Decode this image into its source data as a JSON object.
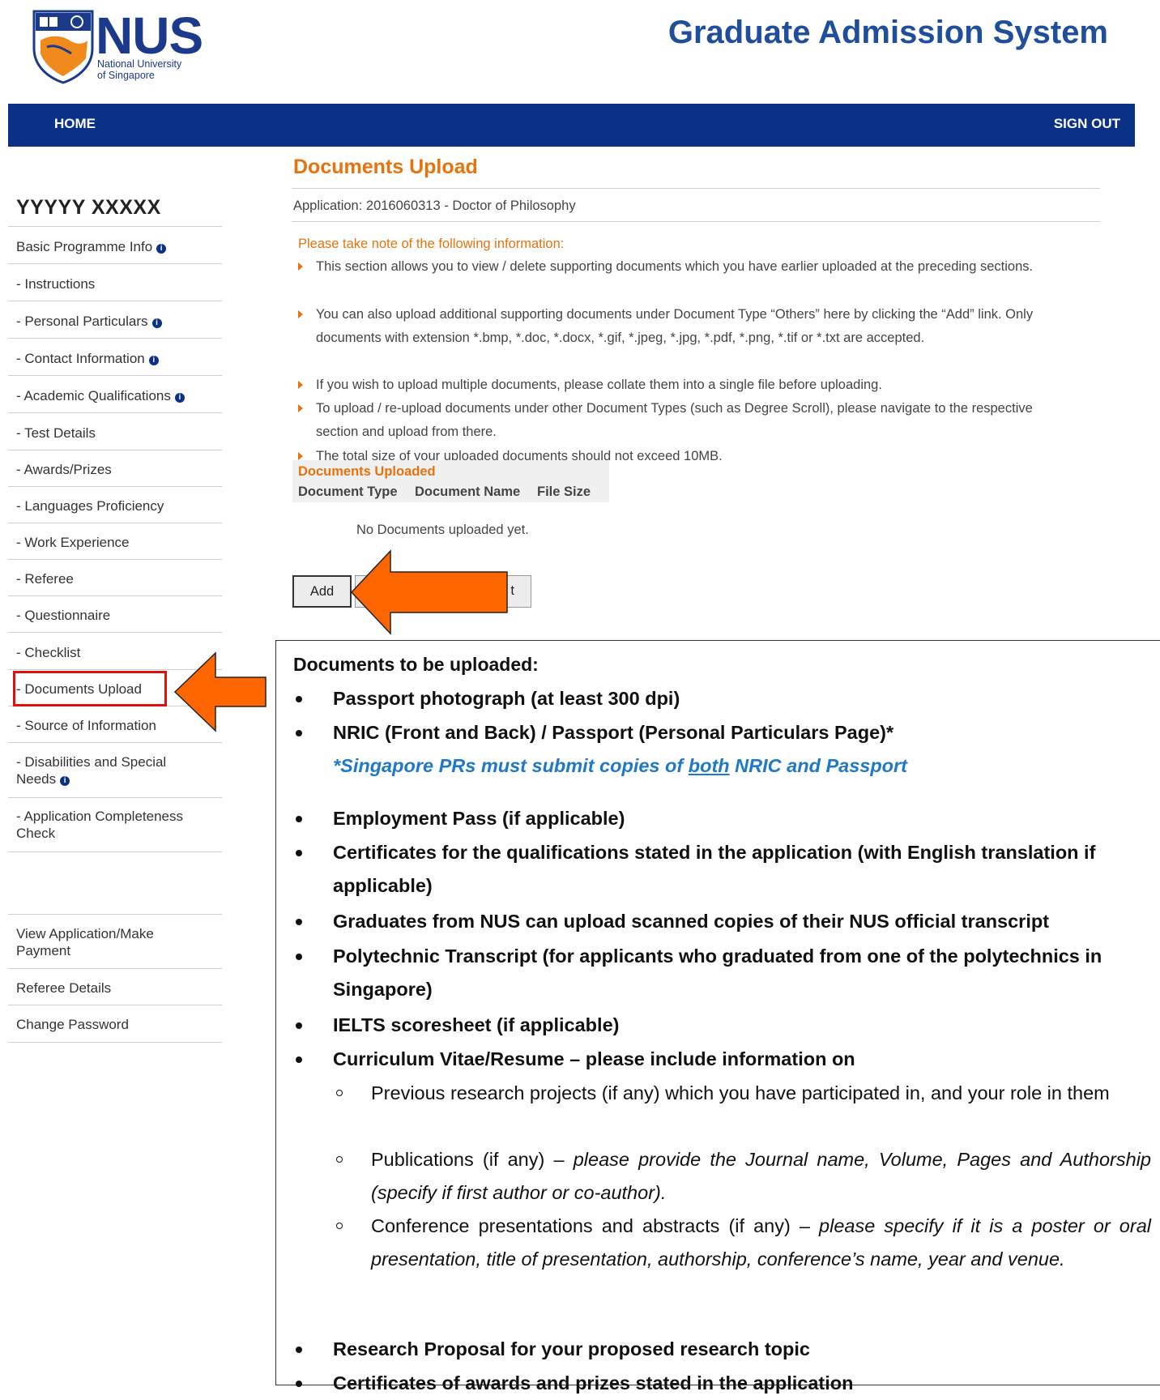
{
  "header": {
    "logo_text": "NUS",
    "logo_subtitle_1": "National University",
    "logo_subtitle_2": "of Singapore",
    "system_title": "Graduate Admission System"
  },
  "nav": {
    "home": "HOME",
    "sign_out": "SIGN OUT"
  },
  "sidebar": {
    "user_name": "YYYYY XXXXX",
    "items": [
      {
        "label": "Basic Programme Info",
        "info": true
      },
      {
        "label": "- Instructions",
        "info": false
      },
      {
        "label": "- Personal Particulars",
        "info": true
      },
      {
        "label": "- Contact Information",
        "info": true
      },
      {
        "label": "- Academic Qualifications",
        "info": true
      },
      {
        "label": "- Test Details",
        "info": false
      },
      {
        "label": "- Awards/Prizes",
        "info": false
      },
      {
        "label": "- Languages Proficiency",
        "info": false
      },
      {
        "label": "- Work Experience",
        "info": false
      },
      {
        "label": "- Referee",
        "info": false
      },
      {
        "label": "- Questionnaire",
        "info": false
      },
      {
        "label": "- Checklist",
        "info": false
      },
      {
        "label": "- Documents Upload",
        "info": false
      },
      {
        "label": "- Source of Information",
        "info": false
      },
      {
        "label": "- Disabilities and Special Needs",
        "info": true
      },
      {
        "label": "- Application Completeness Check",
        "info": false
      }
    ],
    "footer_items": [
      "View Application/Make Payment",
      "Referee Details",
      "Change Password"
    ],
    "info_glyph": "i"
  },
  "main": {
    "title": "Documents Upload",
    "application": "Application: 2016060313 - Doctor of Philosophy",
    "note_heading": "Please take note of the following information:",
    "notes": [
      "This section allows you to view / delete supporting documents which you have earlier uploaded at the preceding sections.",
      "You can also upload additional supporting documents under Document Type “Others” here by clicking the “Add” link. Only documents with extension *.bmp, *.doc, *.docx, *.gif, *.jpeg, *.jpg, *.pdf, *.png, *.tif or *.txt are accepted.",
      "If you wish to upload multiple documents, please collate them into a single file before uploading.",
      "To upload / re-upload documents under other Document Types (such as Degree Scroll), please navigate to the respective section and upload from there.",
      "The total size of your uploaded documents should not exceed 10MB."
    ],
    "uploaded_heading": "Documents Uploaded",
    "columns": [
      "Document Type",
      "Document Name",
      "File Size"
    ],
    "empty_text": "No Documents uploaded yet.",
    "add_button": "Add",
    "second_button_visible": "t"
  },
  "callout": {
    "title": "Documents to be uploaded:",
    "items": [
      "Passport photograph (at least 300 dpi)",
      "NRIC (Front and Back) / Passport (Personal Particulars Page)*",
      "Employment Pass (if applicable)",
      "Certificates for the qualifications stated in the application (with English translation if applicable)",
      "Graduates from NUS can upload scanned copies of their NUS official  transcript",
      "Polytechnic Transcript (for applicants who graduated from one of the polytechnics in Singapore)",
      "IELTS scoresheet (if applicable)",
      "Curriculum Vitae/Resume – please include information on",
      "Research Proposal for your proposed research topic",
      "Certificates of awards and prizes stated in the application"
    ],
    "pr_note_1": "*Singapore PRs must submit copies of ",
    "pr_note_both": "both",
    "pr_note_2": " NRIC and Passport",
    "cv_sub": [
      {
        "plain": "Previous research projects (if any) which you have participated in, and your role in them",
        "italic": ""
      },
      {
        "plain": "Publications (if any) – ",
        "italic": "please provide the Journal name, Volume, Pages and Authorship (specify if first author or co-author)."
      },
      {
        "plain": "Conference presentations and abstracts (if any) – ",
        "italic": "please specify if it is a poster or oral presentation, title of presentation, authorship, conference’s name, year and venue."
      }
    ]
  },
  "colors": {
    "nav_blue": "#0a3185",
    "accent_orange": "#e8720c",
    "arrow_orange": "#ff6600",
    "highlight_red": "#e01010",
    "note_blue": "#1f78c8"
  }
}
